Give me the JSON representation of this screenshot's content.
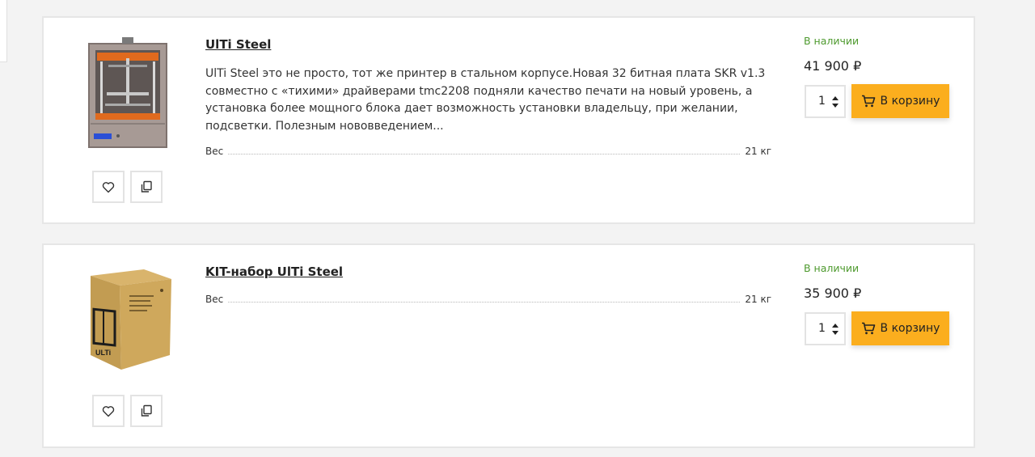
{
  "products": [
    {
      "title": "UlTi Steel",
      "description": "UlTi Steel это не просто, тот же принтер в стальном корпусе.Новая 32 битная плата SKR v1.3 совместно с «тихими» драйверами tmc2208 подняли качество печати на новый уровень, а установка более мощного блока дает возможность установки владельцу, при желании, подсветки. Полезным нововведением...",
      "property_label": "Вес",
      "property_value": "21 кг",
      "stock": "В наличии",
      "price": "41 900 ₽",
      "quantity": "1",
      "cart_label": "В корзину",
      "image_icon": "3d-printer-image"
    },
    {
      "title": "KIT-набор UlTi Steel",
      "property_label": "Вес",
      "property_value": "21 кг",
      "stock": "В наличии",
      "price": "35 900 ₽",
      "quantity": "1",
      "cart_label": "В корзину",
      "image_icon": "kit-box-image",
      "box_text": "ULTi"
    }
  ],
  "colors": {
    "accent": "#fbae1e",
    "stock": "#4e9a2e",
    "card_border": "#e6e6e6",
    "background": "#f3f3f3"
  },
  "icons": {
    "favorite": "heart-icon",
    "compare": "compare-icon",
    "cart": "cart-icon",
    "quantity_arrows": "up-down-arrows-icon"
  }
}
